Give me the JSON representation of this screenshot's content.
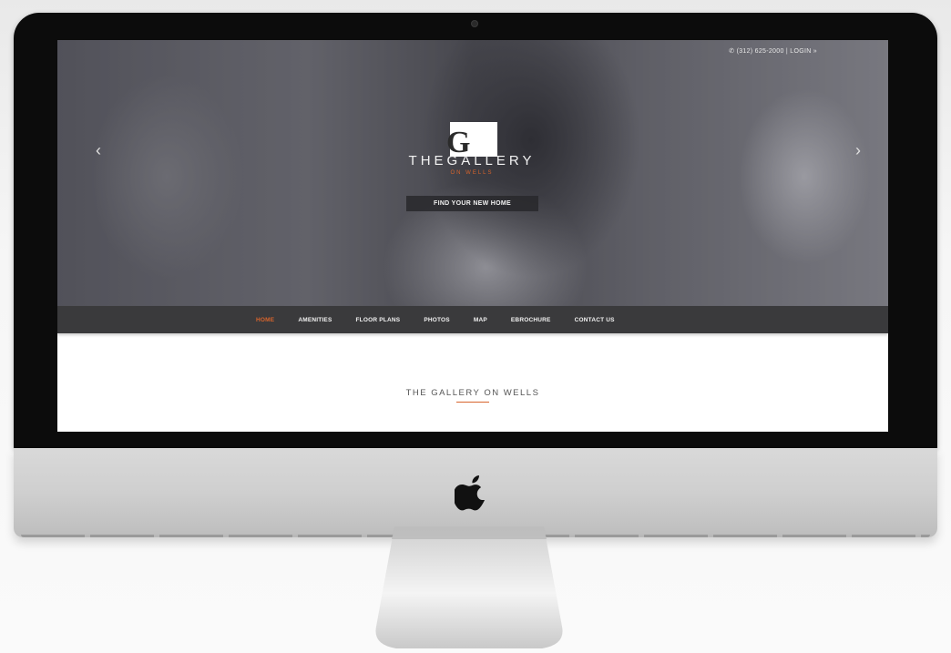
{
  "topbar": {
    "phone_icon": "phone-icon",
    "phone": "(312) 625-2000",
    "separator": "|",
    "login": "LOGIN »"
  },
  "hero": {
    "logo_letter": "G",
    "logo_name": "THEGALLERY",
    "logo_sub": "ON WELLS",
    "cta_label": "FIND YOUR NEW HOME",
    "prev_arrow": "‹",
    "next_arrow": "›"
  },
  "nav": {
    "items": [
      {
        "label": "HOME",
        "active": true
      },
      {
        "label": "AMENITIES"
      },
      {
        "label": "FLOOR PLANS"
      },
      {
        "label": "PHOTOS"
      },
      {
        "label": "MAP"
      },
      {
        "label": "EBROCHURE"
      },
      {
        "label": "CONTACT US"
      }
    ]
  },
  "content": {
    "title": "THE GALLERY ON WELLS"
  },
  "colors": {
    "accent": "#d7642c",
    "nav_bg": "#3a3a3c",
    "bezel": "#0c0c0c"
  }
}
